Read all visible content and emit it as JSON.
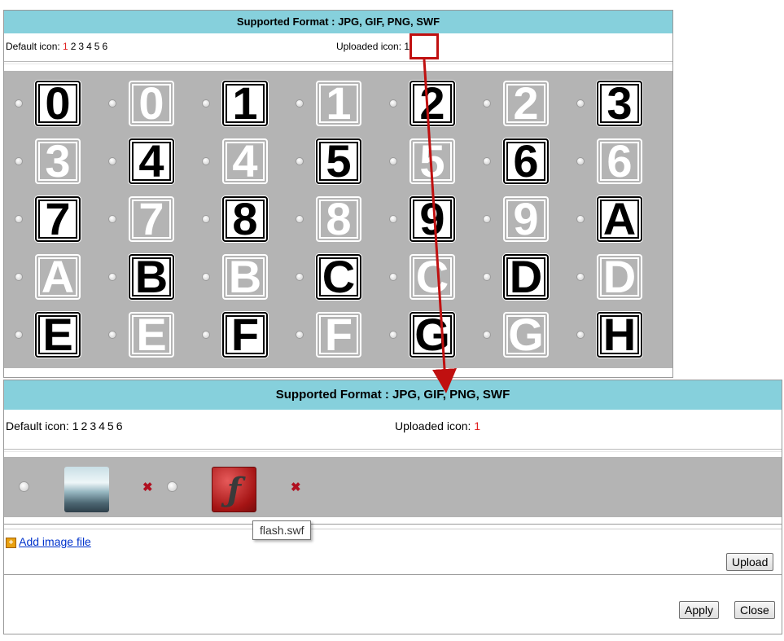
{
  "top_panel": {
    "header": "Supported Format : JPG, GIF, PNG, SWF",
    "default_label": "Default icon:",
    "default_numbers": [
      "1",
      "2",
      "3",
      "4",
      "5",
      "6"
    ],
    "default_active": "1",
    "uploaded_label": "Uploaded icon:",
    "uploaded_numbers": [
      "1"
    ],
    "icons": [
      [
        "0",
        "0",
        "1",
        "1",
        "2",
        "2",
        "3"
      ],
      [
        "3",
        "4",
        "4",
        "5",
        "5",
        "6",
        "6"
      ],
      [
        "7",
        "7",
        "8",
        "8",
        "9",
        "9",
        "A"
      ],
      [
        "A",
        "B",
        "B",
        "C",
        "C",
        "D",
        "D"
      ],
      [
        "E",
        "E",
        "F",
        "F",
        "G",
        "G",
        "H"
      ]
    ],
    "icon_styles": [
      [
        "black",
        "white",
        "black",
        "white",
        "black",
        "white",
        "black"
      ],
      [
        "white",
        "black",
        "white",
        "black",
        "white",
        "black",
        "white"
      ],
      [
        "black",
        "white",
        "black",
        "white",
        "black",
        "white",
        "black"
      ],
      [
        "white",
        "black",
        "white",
        "black",
        "white",
        "black",
        "white"
      ],
      [
        "black",
        "white",
        "black",
        "white",
        "black",
        "white",
        "black"
      ]
    ]
  },
  "bottom_panel": {
    "header": "Supported Format : JPG, GIF, PNG, SWF",
    "default_label": "Default icon:",
    "default_numbers": [
      "1",
      "2",
      "3",
      "4",
      "5",
      "6"
    ],
    "uploaded_label": "Uploaded icon:",
    "uploaded_numbers": [
      "1"
    ],
    "uploaded_active": "1",
    "tooltip": "flash.swf",
    "add_link": "Add image file",
    "upload_button": "Upload",
    "apply_button": "Apply",
    "close_button": "Close"
  },
  "colors": {
    "header_bg": "#86d0dc",
    "grid_bg": "#b4b4b4",
    "active_number": "#e02020",
    "callout": "#c01010"
  }
}
